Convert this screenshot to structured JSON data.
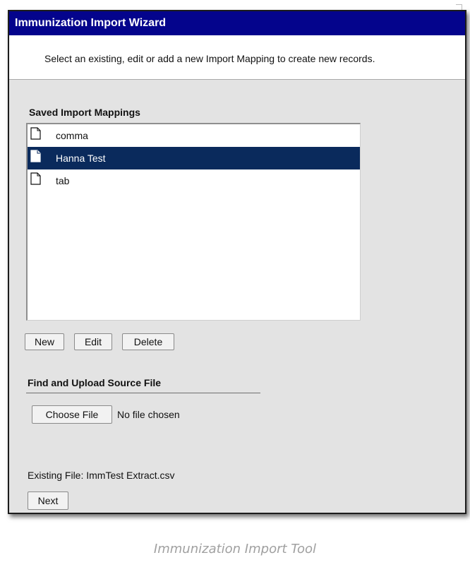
{
  "wizard": {
    "title": "Immunization Import Wizard",
    "instructions": "Select an existing, edit or add a new Import Mapping to create new records."
  },
  "mappings": {
    "label": "Saved Import Mappings",
    "items": [
      {
        "label": "comma",
        "selected": false,
        "icon": "document-icon"
      },
      {
        "label": "Hanna Test",
        "selected": true,
        "icon": "document-icon"
      },
      {
        "label": "tab",
        "selected": false,
        "icon": "document-icon"
      }
    ],
    "buttons": {
      "new_label": "New",
      "edit_label": "Edit",
      "delete_label": "Delete"
    }
  },
  "upload": {
    "label": "Find and Upload Source File",
    "choose_label": "Choose File",
    "no_file_text": "No file chosen",
    "existing_file_text": "Existing File: ImmTest Extract.csv"
  },
  "navigation": {
    "next_label": "Next"
  },
  "caption": "Immunization Import Tool",
  "colors": {
    "title_bar": "#04048c",
    "selected_row": "#0a2a5c",
    "panel_background": "#e3e3e3"
  }
}
